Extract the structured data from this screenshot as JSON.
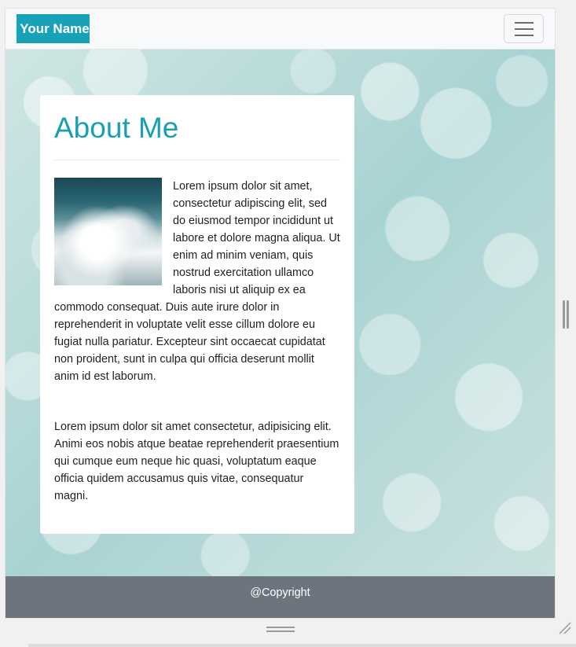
{
  "navbar": {
    "brand": "Your Name",
    "toggle": "menu-icon"
  },
  "colors": {
    "brand_bg": "#17a2b8",
    "heading": "#1a9fb0",
    "footer_bg": "#6c757d"
  },
  "about": {
    "title": "About Me",
    "image": "ocean-waves-photo",
    "paragraph1": "Lorem ipsum dolor sit amet, consectetur adipiscing elit, sed do eiusmod tempor incididunt ut labore et dolore magna aliqua. Ut enim ad minim veniam, quis nostrud exercitation ullamco laboris nisi ut aliquip ex ea commodo consequat. Duis aute irure dolor in reprehenderit in voluptate velit esse cillum dolore eu fugiat nulla pariatur. Excepteur sint occaecat cupidatat non proident, sunt in culpa qui officia deserunt mollit anim id est laborum.",
    "paragraph2": "Lorem ipsum dolor sit amet consectetur, adipisicing elit. Animi eos nobis atque beatae reprehenderit praesentium qui cumque eum neque hic quasi, voluptatum eaque officia quidem accusamus quis vitae, consequatur magni."
  },
  "footer": {
    "text": "@Copyright"
  }
}
